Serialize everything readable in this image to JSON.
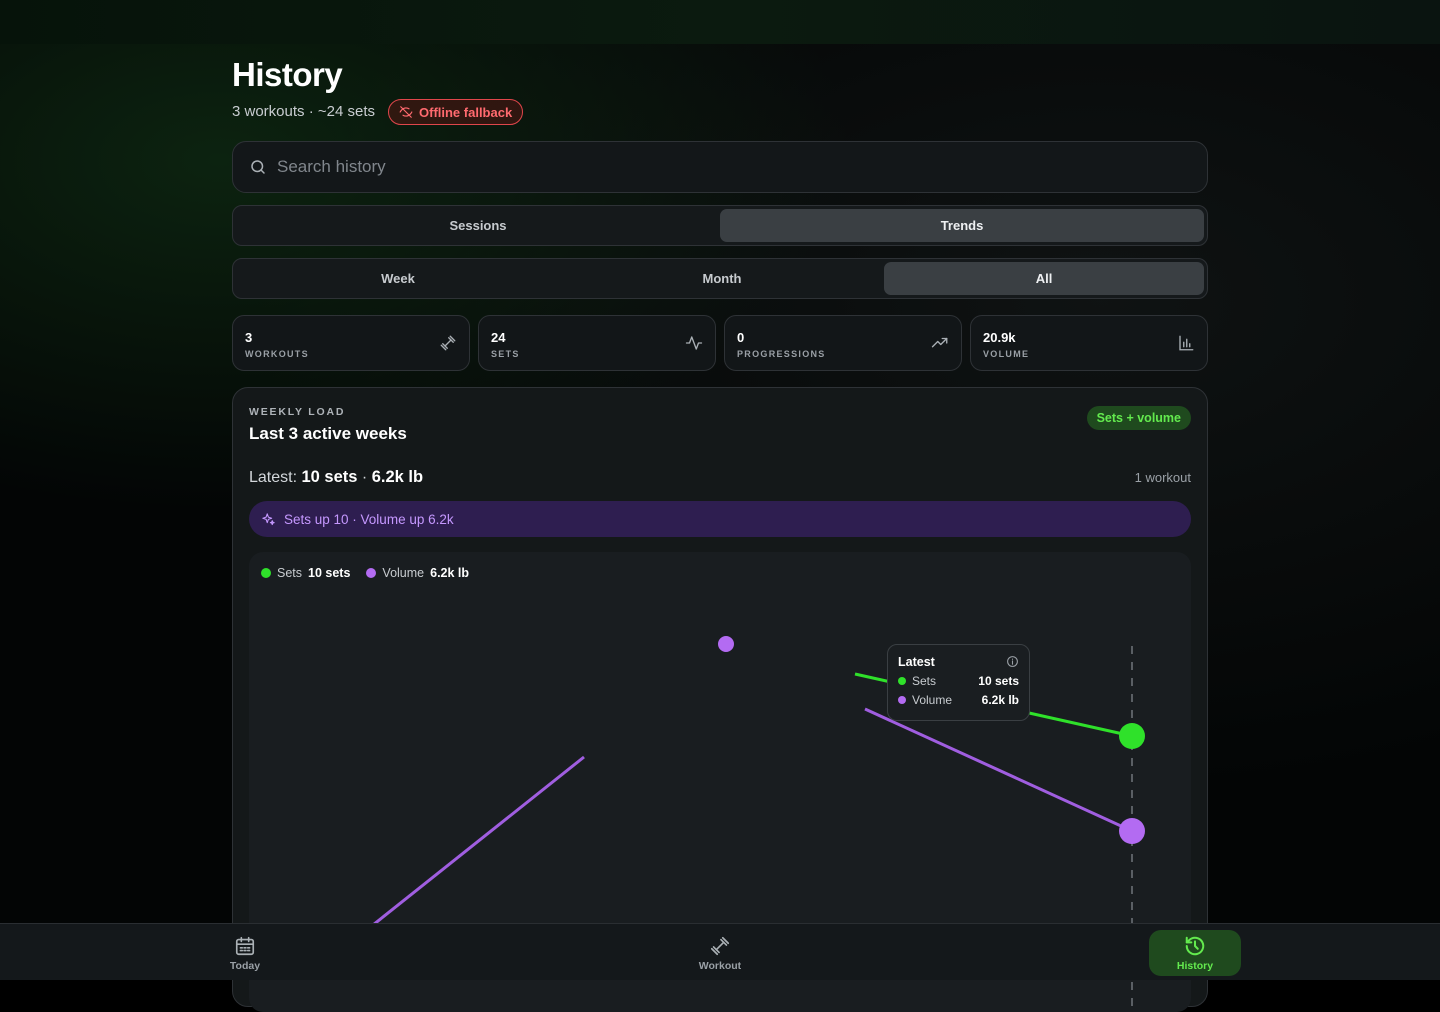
{
  "header": {
    "title": "History",
    "subtitle": "3 workouts · ~24 sets",
    "offline_badge": "Offline fallback"
  },
  "search": {
    "placeholder": "Search history",
    "value": ""
  },
  "view_tabs": [
    {
      "label": "Sessions",
      "active": false
    },
    {
      "label": "Trends",
      "active": true
    }
  ],
  "range_tabs": [
    {
      "label": "Week",
      "active": false
    },
    {
      "label": "Month",
      "active": false
    },
    {
      "label": "All",
      "active": true
    }
  ],
  "stats": [
    {
      "value": "3",
      "label": "WORKOUTS",
      "icon": "dumbbell-icon"
    },
    {
      "value": "24",
      "label": "SETS",
      "icon": "activity-icon"
    },
    {
      "value": "0",
      "label": "PROGRESSIONS",
      "icon": "trending-up-icon"
    },
    {
      "value": "20.9k",
      "label": "VOLUME",
      "icon": "bar-chart-icon"
    }
  ],
  "weekly_load": {
    "eyebrow": "WEEKLY LOAD",
    "title": "Last 3 active weeks",
    "badge": "Sets + volume",
    "latest_prefix": "Latest:",
    "latest_sets": "10 sets",
    "latest_sep": "·",
    "latest_volume": "6.2k lb",
    "workout_count": "1 workout",
    "insight": "Sets up 10 · Volume up 6.2k",
    "legend": [
      {
        "name": "Sets",
        "value": "10 sets",
        "color": "#2fe12a"
      },
      {
        "name": "Volume",
        "value": "6.2k lb",
        "color": "#b36bf2"
      }
    ],
    "tooltip": {
      "title": "Latest",
      "rows": [
        {
          "name": "Sets",
          "value": "10 sets",
          "color": "#2fe12a"
        },
        {
          "name": "Volume",
          "value": "6.2k lb",
          "color": "#b36bf2"
        }
      ]
    }
  },
  "nav": [
    {
      "label": "Today",
      "icon": "calendar-icon",
      "active": false
    },
    {
      "label": "Workout",
      "icon": "dumbbell-icon",
      "active": false
    },
    {
      "label": "History",
      "icon": "history-icon",
      "active": true
    }
  ],
  "colors": {
    "accent_green": "#63ea4e",
    "sets_series": "#2fe12a",
    "volume_series": "#b36bf2",
    "offline_red": "#ff6a6f"
  }
}
